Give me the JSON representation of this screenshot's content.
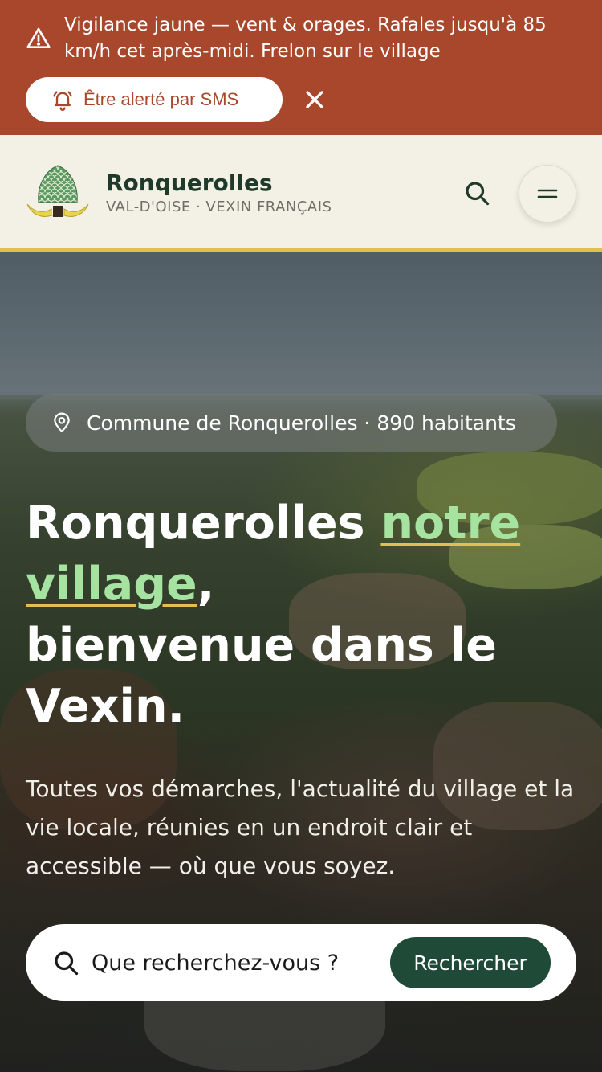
{
  "alert": {
    "message": "Vigilance jaune — vent & orages. Rafales jusqu'à 85 km/h cet après-midi. Frelon sur le village",
    "sms_button_label": "Être alerté par SMS",
    "icon": "warning-triangle-icon",
    "color": "#a8472c"
  },
  "header": {
    "site_name": "Ronquerolles",
    "site_subtitle": "VAL-D'OISE · VEXIN FRANÇAIS",
    "accent_color": "#e4be4e",
    "background": "#f3f1e6"
  },
  "hero": {
    "pill_label": "Commune de Ronquerolles · 890 habitants",
    "title_part1": "Ronquerolles ",
    "title_accent": "notre village",
    "title_part2": ",",
    "title_part3": "bienvenue dans le Vexin.",
    "description": "Toutes vos démarches, l'actualité du village et la vie locale, réunies en un endroit clair et accessible — où que vous soyez.",
    "accent_color": "#a6e3a1"
  },
  "search": {
    "placeholder": "Que recherchez-vous ?",
    "button_label": "Rechercher",
    "button_color": "#1f4a37"
  }
}
